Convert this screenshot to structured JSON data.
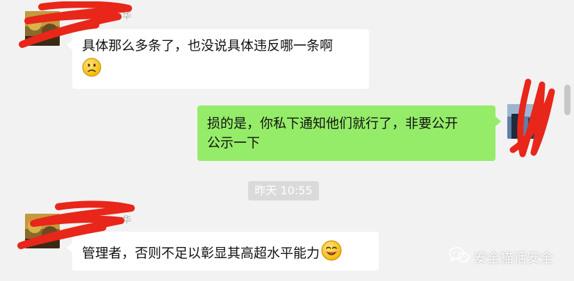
{
  "messages": [
    {
      "nickname": "华",
      "lines": [
        "具体那么多条了，也没说具体违反哪一条啊"
      ],
      "emoji": "frowning-face"
    },
    {
      "lines": [
        "损的是，你私下通知他们就行了，非要公开",
        "公示一下"
      ]
    },
    {
      "nickname": "华",
      "lines": [
        "管理者，否则不足以彰显其高超水平能力"
      ],
      "emoji": "smiling-face"
    }
  ],
  "timestamp": "昨天 10:55",
  "watermark": {
    "text": "安全猫话安全",
    "icon": "wechat-icon"
  },
  "colors": {
    "background": "#f2f2f2",
    "incoming_bubble": "#ffffff",
    "outgoing_bubble": "#95ec69",
    "redaction": "#e8261a",
    "timestamp_pill": "#dadada"
  }
}
